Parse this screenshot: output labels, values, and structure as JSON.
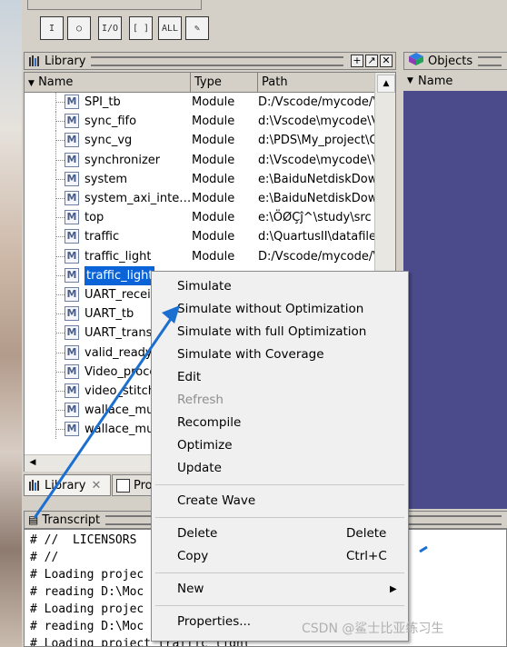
{
  "colors": {
    "selection": "#0a64d8",
    "objects_bg": "#4b4b8c",
    "arrow": "#1a6fd1",
    "menu_bg": "#f0f0f0"
  },
  "toolbar": {
    "buttons": [
      {
        "icon": "I-bar-icon",
        "glyph": "I"
      },
      {
        "icon": "circle-icon",
        "glyph": "○"
      },
      {
        "icon": "io-icon",
        "glyph": "I/O"
      },
      {
        "icon": "bracket-icon",
        "glyph": "[ ]"
      },
      {
        "icon": "all-icon",
        "glyph": "ALL"
      },
      {
        "icon": "wand-icon",
        "glyph": "✎"
      }
    ]
  },
  "library": {
    "title": "Library",
    "columns": [
      "Name",
      "Type",
      "Path"
    ],
    "rows": [
      {
        "name": "SPI_tb",
        "type": "Module",
        "path": "D:/Vscode/mycode/V"
      },
      {
        "name": "sync_fifo",
        "type": "Module",
        "path": "d:\\Vscode\\mycode\\V"
      },
      {
        "name": "sync_vg",
        "type": "Module",
        "path": "d:\\PDS\\My_project\\C"
      },
      {
        "name": "synchronizer",
        "type": "Module",
        "path": "d:\\Vscode\\mycode\\V"
      },
      {
        "name": "system",
        "type": "Module",
        "path": "e:\\BaiduNetdiskDowr"
      },
      {
        "name": "system_axi_inte…",
        "type": "Module",
        "path": "e:\\BaiduNetdiskDowr"
      },
      {
        "name": "top",
        "type": "Module",
        "path": "e:\\ÖØÇĵ^\\study\\src"
      },
      {
        "name": "traffic",
        "type": "Module",
        "path": "d:\\QuartusII\\datafile"
      },
      {
        "name": "traffic_light",
        "type": "Module",
        "path": "D:/Vscode/mycode/V"
      },
      {
        "name": "traffic_light",
        "type": "",
        "path": ""
      },
      {
        "name": "UART_recei",
        "type": "",
        "path": ""
      },
      {
        "name": "UART_tb",
        "type": "",
        "path": ""
      },
      {
        "name": "UART_trans",
        "type": "",
        "path": ""
      },
      {
        "name": "valid_ready",
        "type": "",
        "path": ""
      },
      {
        "name": "Video_proce",
        "type": "",
        "path": ""
      },
      {
        "name": "video_stitch",
        "type": "",
        "path": ""
      },
      {
        "name": "wallace_mul",
        "type": "",
        "path": ""
      },
      {
        "name": "wallace_mul",
        "type": "",
        "path": ""
      }
    ],
    "selected_index": 9,
    "tabs": [
      "Library",
      "Pro"
    ]
  },
  "objects": {
    "title": "Objects",
    "column": "Name"
  },
  "transcript": {
    "title": "Transcript",
    "lines": [
      "# //  LICENSORS",
      "# //",
      "# Loading projec",
      "# reading D:\\Moc",
      "# Loading projec",
      "# reading D:\\Moc",
      "# Loading project traffic_light"
    ]
  },
  "context_menu": {
    "groups": [
      [
        {
          "label": "Simulate",
          "enabled": true
        },
        {
          "label": "Simulate without Optimization",
          "enabled": true
        },
        {
          "label": "Simulate with full Optimization",
          "enabled": true
        },
        {
          "label": "Simulate with Coverage",
          "enabled": true
        },
        {
          "label": "Edit",
          "enabled": true
        },
        {
          "label": "Refresh",
          "enabled": false
        },
        {
          "label": "Recompile",
          "enabled": true
        },
        {
          "label": "Optimize",
          "enabled": true
        },
        {
          "label": "Update",
          "enabled": true
        }
      ],
      [
        {
          "label": "Create Wave",
          "enabled": true
        }
      ],
      [
        {
          "label": "Delete",
          "shortcut": "Delete",
          "enabled": true
        },
        {
          "label": "Copy",
          "shortcut": "Ctrl+C",
          "enabled": true
        }
      ],
      [
        {
          "label": "New",
          "submenu": true,
          "enabled": true
        }
      ],
      [
        {
          "label": "Properties...",
          "enabled": true
        }
      ]
    ]
  },
  "watermark": "CSDN @鲨士比亚练习生"
}
